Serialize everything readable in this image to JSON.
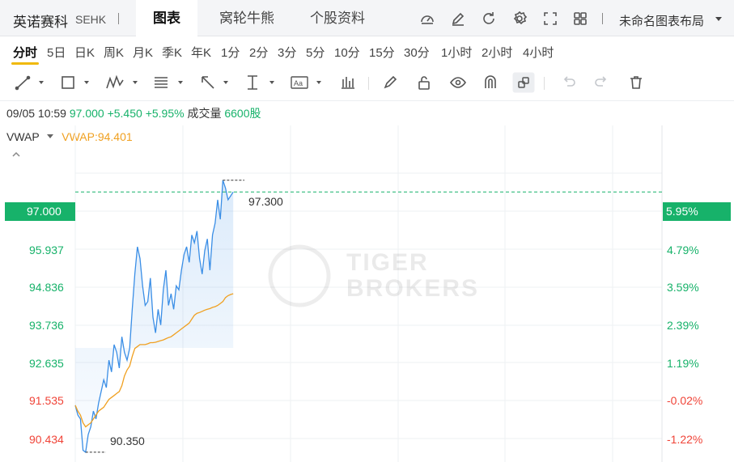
{
  "header": {
    "stock_name": "英诺赛科",
    "stock_code": "SEHK",
    "tabs": [
      "图表",
      "窝轮牛熊",
      "个股资料"
    ],
    "active_tab": "图表",
    "layout_name": "未命名图表布局"
  },
  "periods": [
    "分时",
    "5日",
    "日K",
    "周K",
    "月K",
    "季K",
    "年K",
    "1分",
    "2分",
    "3分",
    "5分",
    "10分",
    "15分",
    "30分",
    "1小时",
    "2小时",
    "4小时"
  ],
  "active_period": "分时",
  "quote": {
    "datetime": "09/05 10:59",
    "price": "97.000",
    "change": "+5.450",
    "change_pct": "+5.95%",
    "volume_label": "成交量",
    "volume": "6600股"
  },
  "indicator": {
    "name": "VWAP",
    "value_text": "VWAP:94.401"
  },
  "watermark": [
    "TIGER",
    "BROKERS"
  ],
  "colors": {
    "up": "#17b26a",
    "down": "#f04438",
    "price_line": "#3a8ee6",
    "vwap_line": "#f0a020"
  },
  "chart_data": {
    "type": "line",
    "y_left_ticks": [
      "97.000",
      "95.937",
      "94.836",
      "93.736",
      "92.635",
      "91.535",
      "90.434"
    ],
    "y_right_ticks": [
      "5.95%",
      "4.79%",
      "3.59%",
      "2.39%",
      "1.19%",
      "-0.02%",
      "-1.22%"
    ],
    "current_price_label": "97.000",
    "current_pct_label": "5.95%",
    "high_label": "97.300",
    "low_label": "90.350",
    "ylim": [
      90.1,
      98.7
    ],
    "prev_close": 91.55,
    "grid": true,
    "series": [
      {
        "name": "price",
        "values": [
          91.55,
          91.3,
          91.2,
          90.4,
          90.35,
          90.8,
          91.0,
          91.4,
          91.2,
          91.6,
          91.9,
          92.2,
          92.0,
          92.7,
          92.4,
          93.1,
          92.9,
          92.5,
          93.3,
          92.9,
          92.7,
          93.0,
          94.0,
          94.9,
          95.6,
          95.3,
          94.6,
          94.1,
          94.2,
          94.8,
          93.8,
          93.4,
          94.0,
          93.6,
          94.5,
          95.0,
          94.1,
          94.4,
          94.0,
          94.6,
          94.5,
          95.0,
          95.4,
          95.6,
          95.2,
          95.9,
          95.7,
          96.0,
          95.3,
          94.9,
          95.5,
          95.8,
          95.0,
          95.9,
          96.2,
          96.8,
          96.3,
          97.3,
          97.1,
          96.8,
          96.9,
          97.0
        ]
      },
      {
        "name": "VWAP",
        "values": [
          91.55,
          91.4,
          91.3,
          91.1,
          91.0,
          91.05,
          91.1,
          91.2,
          91.3,
          91.4,
          91.45,
          91.5,
          91.6,
          91.7,
          91.75,
          91.8,
          91.85,
          91.9,
          92.05,
          92.3,
          92.45,
          92.55,
          92.8,
          93.0,
          93.05,
          93.1,
          93.1,
          93.1,
          93.12,
          93.15,
          93.15,
          93.16,
          93.18,
          93.2,
          93.22,
          93.25,
          93.28,
          93.3,
          93.35,
          93.4,
          93.45,
          93.5,
          93.55,
          93.6,
          93.65,
          93.75,
          93.85,
          93.9,
          93.92,
          93.95,
          93.98,
          94.0,
          94.02,
          94.05,
          94.07,
          94.1,
          94.15,
          94.2,
          94.3,
          94.35,
          94.38,
          94.401
        ]
      }
    ]
  }
}
